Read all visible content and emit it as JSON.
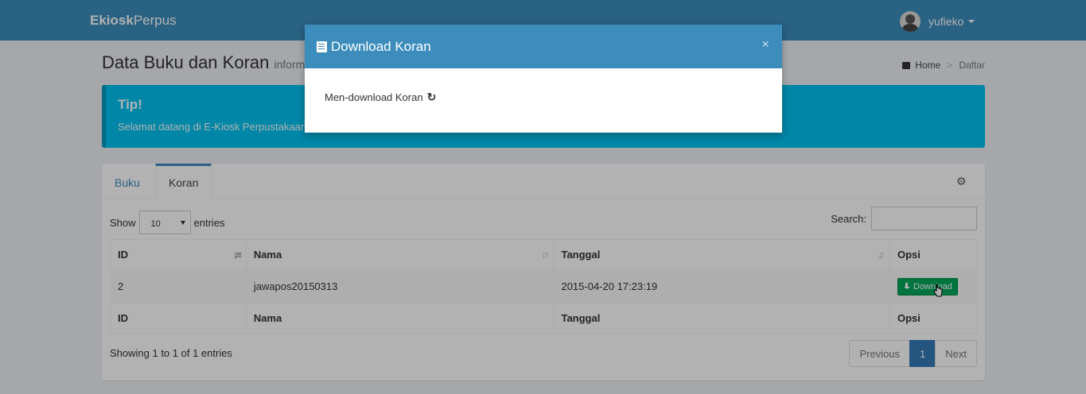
{
  "navbar": {
    "brand_bold": "Ekiosk",
    "brand_rest": "Perpus",
    "username": "yufieko"
  },
  "header": {
    "title": "Data Buku dan Koran",
    "subtitle": "inform",
    "breadcrumb_home": "Home",
    "breadcrumb_current": "Daftar"
  },
  "callout": {
    "title": "Tip!",
    "text": "Selamat datang di E-Kiosk Perpustakaan"
  },
  "tabs": {
    "buku": "Buku",
    "koran": "Koran"
  },
  "table_controls": {
    "show_label": "Show",
    "entries_label": "entries",
    "page_length": "10",
    "search_label": "Search:"
  },
  "table": {
    "headers": [
      "ID",
      "Nama",
      "Tanggal",
      "Opsi"
    ],
    "rows": [
      {
        "id": "2",
        "nama": "jawapos20150313",
        "tanggal": "2015-04-20 17:23:19",
        "action": "Download"
      }
    ],
    "footers": [
      "ID",
      "Nama",
      "Tanggal",
      "Opsi"
    ]
  },
  "footer": {
    "info": "Showing 1 to 1 of 1 entries",
    "prev": "Previous",
    "page": "1",
    "next": "Next"
  },
  "modal": {
    "title": "Download Koran",
    "close": "×",
    "body": "Men-download Koran",
    "refresh_icon": "↻"
  },
  "colors": {
    "primary": "#3c8dbc",
    "info": "#00c0ef",
    "success": "#00a65a"
  }
}
